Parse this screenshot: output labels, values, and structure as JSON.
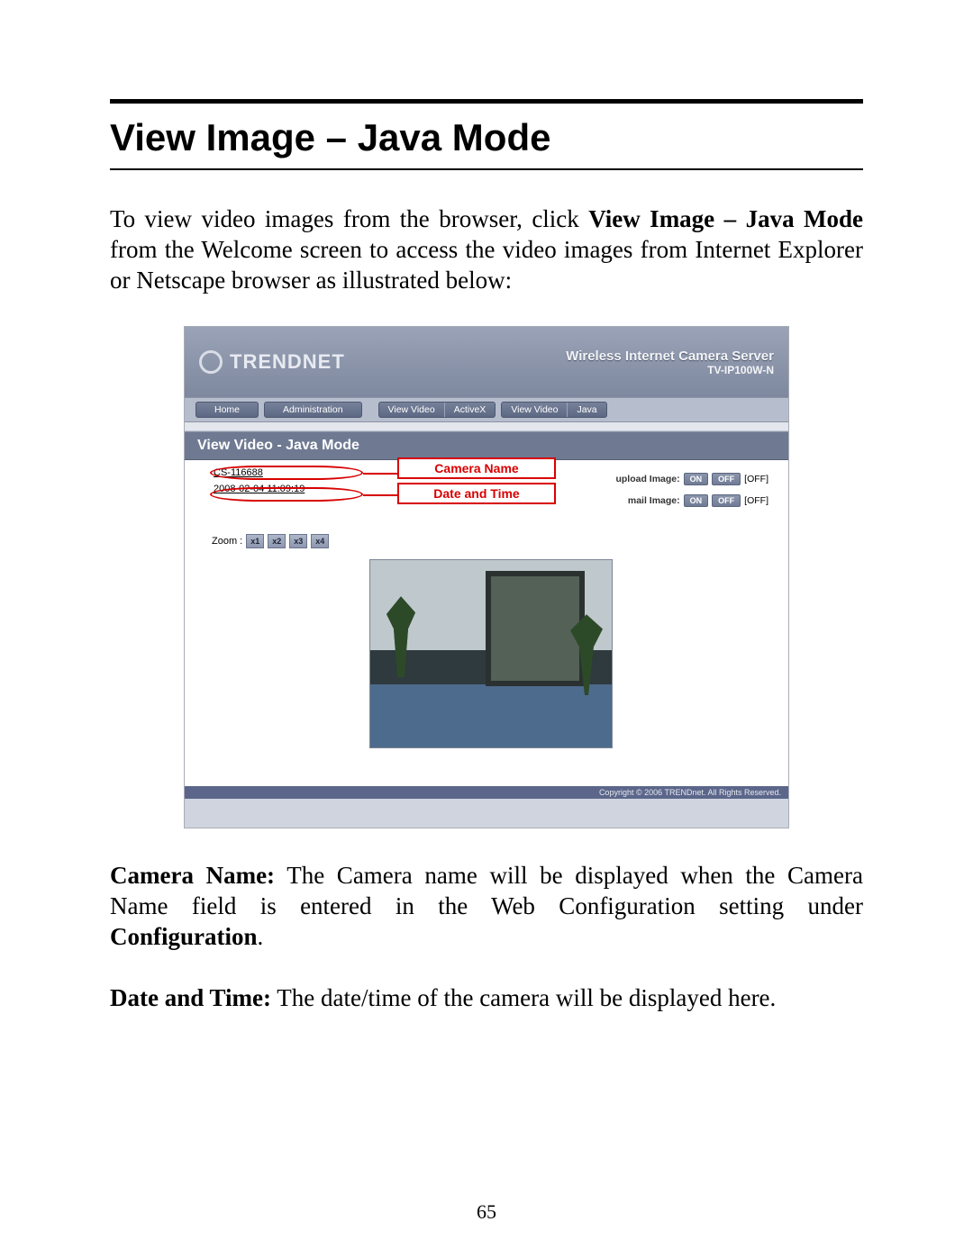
{
  "heading": "View Image – Java Mode",
  "para1_a": "To view video images from the browser, click ",
  "para1_b": "View Image – Java Mode",
  "para1_c": " from the Welcome screen to access the video images from Internet Explorer or Netscape browser as illustrated below:",
  "screenshot": {
    "brand": "TRENDNET",
    "title_main": "Wireless Internet Camera Server",
    "title_sub": "TV-IP100W-N",
    "nav": {
      "home": "Home",
      "admin": "Administration",
      "vv": "View Video",
      "ax": "ActiveX",
      "vv2": "View Video",
      "java": "Java"
    },
    "subhead": "View Video - Java Mode",
    "camera_name": "CS-116688",
    "datetime": "2008-02-04 11:09:19",
    "annot_camera": "Camera Name",
    "annot_datetime": "Date and Time",
    "upload_lbl": "upload Image:",
    "mail_lbl": "mail Image:",
    "on": "ON",
    "off": "OFF",
    "off_state": "[OFF]",
    "zoom_lbl": "Zoom :",
    "zoom": [
      "x1",
      "x2",
      "x3",
      "x4"
    ],
    "footer": "Copyright © 2006 TRENDnet. All Rights Reserved."
  },
  "para2_a": "Camera Name:",
  "para2_b": " The Camera name will be displayed when the Camera Name field is entered in the Web Configuration setting under ",
  "para2_c": "Configuration",
  "para2_d": ".",
  "para3_a": "Date and Time:",
  "para3_b": " The date/time of the camera will be displayed here.",
  "page_num": "65"
}
